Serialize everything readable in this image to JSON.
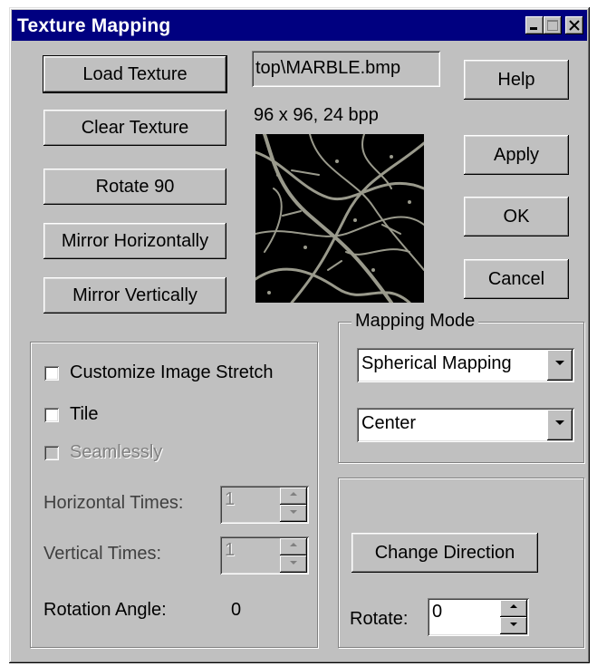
{
  "window": {
    "title": "Texture Mapping"
  },
  "buttons": {
    "load_texture": "Load Texture",
    "clear_texture": "Clear Texture",
    "rotate_90": "Rotate 90",
    "mirror_horizontally": "Mirror Horizontally",
    "mirror_vertically": "Mirror Vertically",
    "help": "Help",
    "apply": "Apply",
    "ok": "OK",
    "cancel": "Cancel",
    "change_direction": "Change Direction"
  },
  "texture": {
    "file_name": "top\\MARBLE.bmp",
    "info": "96 x 96, 24 bpp",
    "preview_icon": "marble-texture"
  },
  "stretch_group": {
    "customize_label": "Customize Image Stretch",
    "customize_checked": false,
    "tile_label": "Tile",
    "tile_checked": false,
    "seamlessly_label": "Seamlessly",
    "seamlessly_enabled": false,
    "horizontal_times_label": "Horizontal Times:",
    "horizontal_times_value": "1",
    "vertical_times_label": "Vertical Times:",
    "vertical_times_value": "1",
    "rotation_angle_label": "Rotation Angle:",
    "rotation_angle_value": "0"
  },
  "mapping_mode": {
    "title": "Mapping Mode",
    "mode_value": "Spherical Mapping",
    "alignment_value": "Center"
  },
  "direction_group": {
    "rotate_label": "Rotate:",
    "rotate_value": "0"
  },
  "colors": {
    "titlebar": "#000080",
    "face": "#c0c0c0"
  }
}
